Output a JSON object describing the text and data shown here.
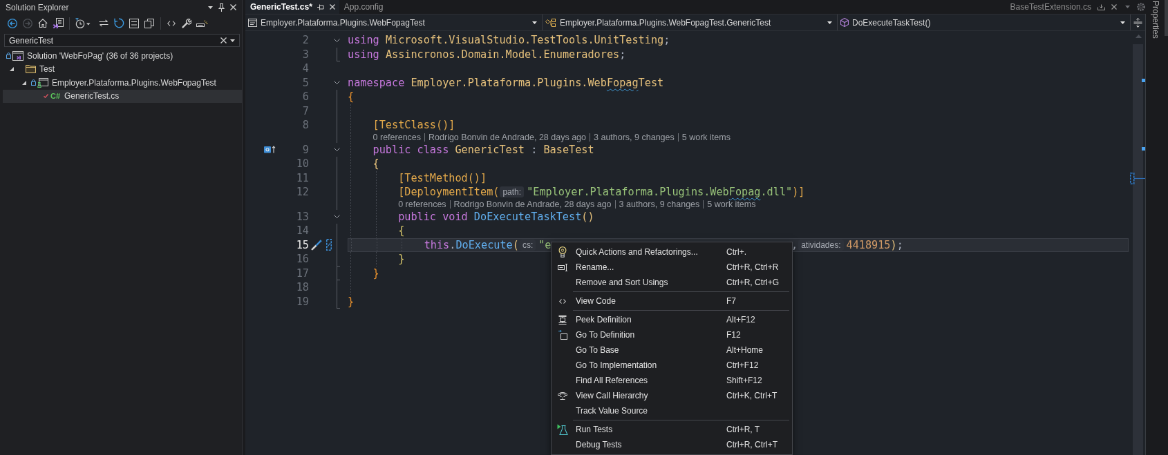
{
  "solution_explorer": {
    "title": "Solution Explorer",
    "toolbar": [
      {
        "disabled": false
      },
      {
        "disabled": true
      },
      {
        "disabled": false
      },
      {
        "disabled": false
      },
      {
        "disabled": false
      },
      {
        "disabled": false
      },
      {
        "disabled": false
      },
      {
        "disabled": false
      },
      {
        "disabled": false
      },
      {
        "disabled": false
      },
      {
        "disabled": false
      },
      {
        "disabled": false
      }
    ],
    "search": {
      "value": "GenericTest"
    },
    "tree": [
      {
        "kind": "solution",
        "label": "Solution 'WebFoPag' (36 of 36 projects)",
        "locked": true,
        "checked_out": false,
        "selected": false,
        "children": [
          {
            "kind": "folder",
            "label": "Test",
            "expanded": true,
            "locked": false,
            "checked_out": false,
            "selected": false,
            "children": [
              {
                "kind": "project",
                "label": "Employer.Plataforma.Plugins.WebFopagTest",
                "locked": true,
                "checked_out": false,
                "expanded": true,
                "selected": false,
                "children": [
                  {
                    "kind": "file",
                    "label": "GenericTest.cs",
                    "icon_text": "C#",
                    "locked": false,
                    "checked_out": true,
                    "selected": true
                  }
                ]
              }
            ]
          }
        ]
      }
    ]
  },
  "editor": {
    "tabs": [
      {
        "label": "GenericTest.cs*",
        "selected": true
      },
      {
        "label": "App.config",
        "selected": false
      }
    ],
    "preview_tab": {
      "label": "BaseTestExtension.cs"
    },
    "nav": [
      {
        "text": "Employer.Plataforma.Plugins.WebFopagTest"
      },
      {
        "text": "Employer.Plataforma.Plugins.WebFopagTest.GenericTest"
      },
      {
        "text": "DoExecuteTaskTest()"
      }
    ],
    "lines": [
      {
        "number": "2",
        "expanded": true,
        "current": false,
        "tokens": [
          {
            "kind": "keyword",
            "text": "using "
          },
          {
            "kind": "namespace",
            "text": "Microsoft.VisualStudio.TestTools.UnitTesting"
          },
          {
            "kind": "punct",
            "text": ";"
          }
        ]
      },
      {
        "number": "3",
        "current": false,
        "fold_end": true,
        "tokens": [
          {
            "kind": "keyword",
            "text": "using "
          },
          {
            "kind": "namespace",
            "text": "Assincronos.Domain.Model.Enumeradores"
          },
          {
            "kind": "punct",
            "text": ";"
          }
        ]
      },
      {
        "number": "4",
        "current": false
      },
      {
        "number": "5",
        "expanded": true,
        "current": false,
        "tokens": [
          {
            "kind": "keyword",
            "text": "namespace "
          },
          {
            "kind": "namespace",
            "text": "Employer.Plataforma.Plugins.Web"
          },
          {
            "kind": "namespace",
            "text": "Fopag",
            "misspelled": true
          },
          {
            "kind": "namespace",
            "text": "Test"
          }
        ]
      },
      {
        "number": "6",
        "current": false,
        "tokens": [
          {
            "kind": "brace1",
            "text": "{"
          }
        ]
      },
      {
        "number": "7",
        "current": false
      },
      {
        "number": "8",
        "current": false,
        "tokens": [
          {
            "kind": "attribute",
            "text": "[TestClass()]"
          }
        ]
      },
      {
        "number": "9",
        "expanded": true,
        "current": false,
        "base_marker": true,
        "codelens": [
          "0 references",
          "Rodrigo Bonvin de Andrade, 28 days ago",
          "3 authors, 9 changes",
          "5 work items"
        ],
        "tokens": [
          {
            "kind": "keyword",
            "text": "public class "
          },
          {
            "kind": "type",
            "text": "GenericTest"
          },
          {
            "kind": "punct",
            "text": " : "
          },
          {
            "kind": "type",
            "text": "BaseTest"
          }
        ]
      },
      {
        "number": "10",
        "current": false,
        "tokens": [
          {
            "kind": "brace2",
            "text": "{"
          }
        ]
      },
      {
        "number": "11",
        "current": false,
        "tokens": [
          {
            "kind": "attribute",
            "text": "[TestMethod()]"
          }
        ]
      },
      {
        "number": "12",
        "current": false,
        "tokens": [
          {
            "kind": "attribute",
            "text": "[DeploymentItem("
          },
          {
            "kind": "hint",
            "text": "path:"
          },
          {
            "kind": "string",
            "text": "\"Employer.Plataforma.Plugins.Web"
          },
          {
            "kind": "string",
            "text": "Fopag",
            "misspelled": true
          },
          {
            "kind": "string",
            "text": ".dll\""
          },
          {
            "kind": "attribute",
            "text": ")]"
          }
        ]
      },
      {
        "number": "13",
        "expanded": true,
        "current": false,
        "codelens": [
          "0 references",
          "Rodrigo Bonvin de Andrade, 28 days ago",
          "3 authors, 9 changes",
          "5 work items"
        ],
        "tokens": [
          {
            "kind": "keyword",
            "text": "public void "
          },
          {
            "kind": "method",
            "text": "DoExecuteTaskTest"
          },
          {
            "kind": "brace2",
            "text": "()"
          }
        ]
      },
      {
        "number": "14",
        "current": false,
        "tokens": [
          {
            "kind": "brace3",
            "text": "{"
          }
        ]
      },
      {
        "number": "15",
        "current": true,
        "quick_action": true,
        "changed": true,
        "tokens": [
          {
            "kind": "keyword",
            "text": "this"
          },
          {
            "kind": "punct",
            "text": "."
          },
          {
            "kind": "method",
            "text": "DoExecute"
          },
          {
            "kind": "brace2",
            "text": "("
          },
          {
            "kind": "hint",
            "text": "cs:"
          },
          {
            "kind": "string",
            "text": "\"e"
          },
          {
            "kind": "covered"
          },
          {
            "kind": "punct",
            "text": ","
          },
          {
            "kind": "hint",
            "text": "atividades:"
          },
          {
            "kind": "number",
            "text": "4418915"
          },
          {
            "kind": "brace2",
            "text": ")"
          },
          {
            "kind": "punct",
            "text": ";"
          }
        ]
      },
      {
        "number": "16",
        "current": false,
        "fold_end": true,
        "tokens": [
          {
            "kind": "brace3",
            "text": "}"
          }
        ]
      },
      {
        "number": "17",
        "current": false,
        "fold_end": true,
        "tokens": [
          {
            "kind": "brace1",
            "text": "}"
          }
        ]
      },
      {
        "number": "18",
        "current": false
      },
      {
        "number": "19",
        "current": false,
        "fold_end": true,
        "tokens": [
          {
            "kind": "brace1",
            "text": "}"
          }
        ]
      }
    ]
  },
  "context_menu": {
    "items": [
      {
        "kind": "command",
        "label": "Quick Actions and Refactorings...",
        "shortcut": "Ctrl+."
      },
      {
        "kind": "command",
        "label": "Rename...",
        "shortcut": "Ctrl+R, Ctrl+R"
      },
      {
        "kind": "command",
        "label": "Remove and Sort Usings",
        "shortcut": "Ctrl+R, Ctrl+G"
      },
      {
        "kind": "separator"
      },
      {
        "kind": "command",
        "label": "View Code",
        "shortcut": "F7"
      },
      {
        "kind": "separator"
      },
      {
        "kind": "command",
        "label": "Peek Definition",
        "shortcut": "Alt+F12"
      },
      {
        "kind": "command",
        "label": "Go To Definition",
        "shortcut": "F12"
      },
      {
        "kind": "command",
        "label": "Go To Base",
        "shortcut": "Alt+Home"
      },
      {
        "kind": "command",
        "label": "Go To Implementation",
        "shortcut": "Ctrl+F12"
      },
      {
        "kind": "command",
        "label": "Find All References",
        "shortcut": "Shift+F12"
      },
      {
        "kind": "command",
        "label": "View Call Hierarchy",
        "shortcut": "Ctrl+K, Ctrl+T"
      },
      {
        "kind": "command",
        "label": "Track Value Source"
      },
      {
        "kind": "separator"
      },
      {
        "kind": "command",
        "label": "Run Tests",
        "shortcut": "Ctrl+R, T"
      },
      {
        "kind": "command",
        "label": "Debug Tests",
        "shortcut": "Ctrl+R, Ctrl+T"
      }
    ]
  },
  "side_tabs": [
    {
      "label": "Properties"
    }
  ]
}
